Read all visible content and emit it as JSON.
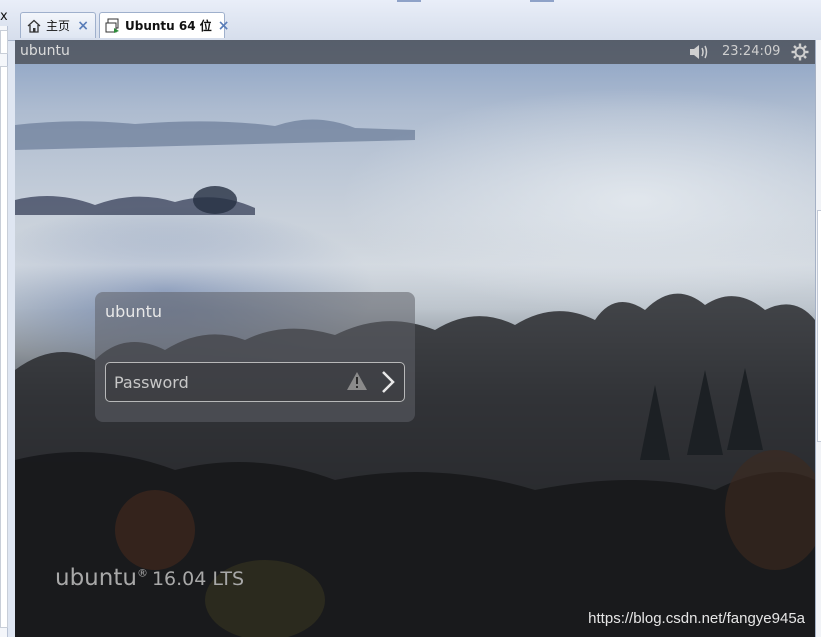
{
  "browser": {
    "close_glyph": "x",
    "tabs": [
      {
        "label": "主页",
        "icon": "home-icon",
        "close": "×"
      },
      {
        "label": "Ubuntu 64 位",
        "icon": "vm-icon",
        "close": "×"
      }
    ]
  },
  "ubuntu": {
    "panel": {
      "hostname": "ubuntu",
      "clock": "23:24:09",
      "volume_icon": "speaker-icon",
      "session_icon": "gear-icon"
    },
    "greeter": {
      "username": "ubuntu",
      "password_placeholder": "Password",
      "warning_icon": "caps-lock-warning-icon",
      "submit_icon": "chevron-right-icon"
    },
    "logo": {
      "brand": "ubuntu",
      "registered": "®",
      "version": "16.04 LTS"
    }
  },
  "watermark": "https://blog.csdn.net/fangye945a",
  "colors": {
    "panel": "#46484e",
    "tab_close": "#5a7db8",
    "text_light": "#e8e8e8"
  }
}
